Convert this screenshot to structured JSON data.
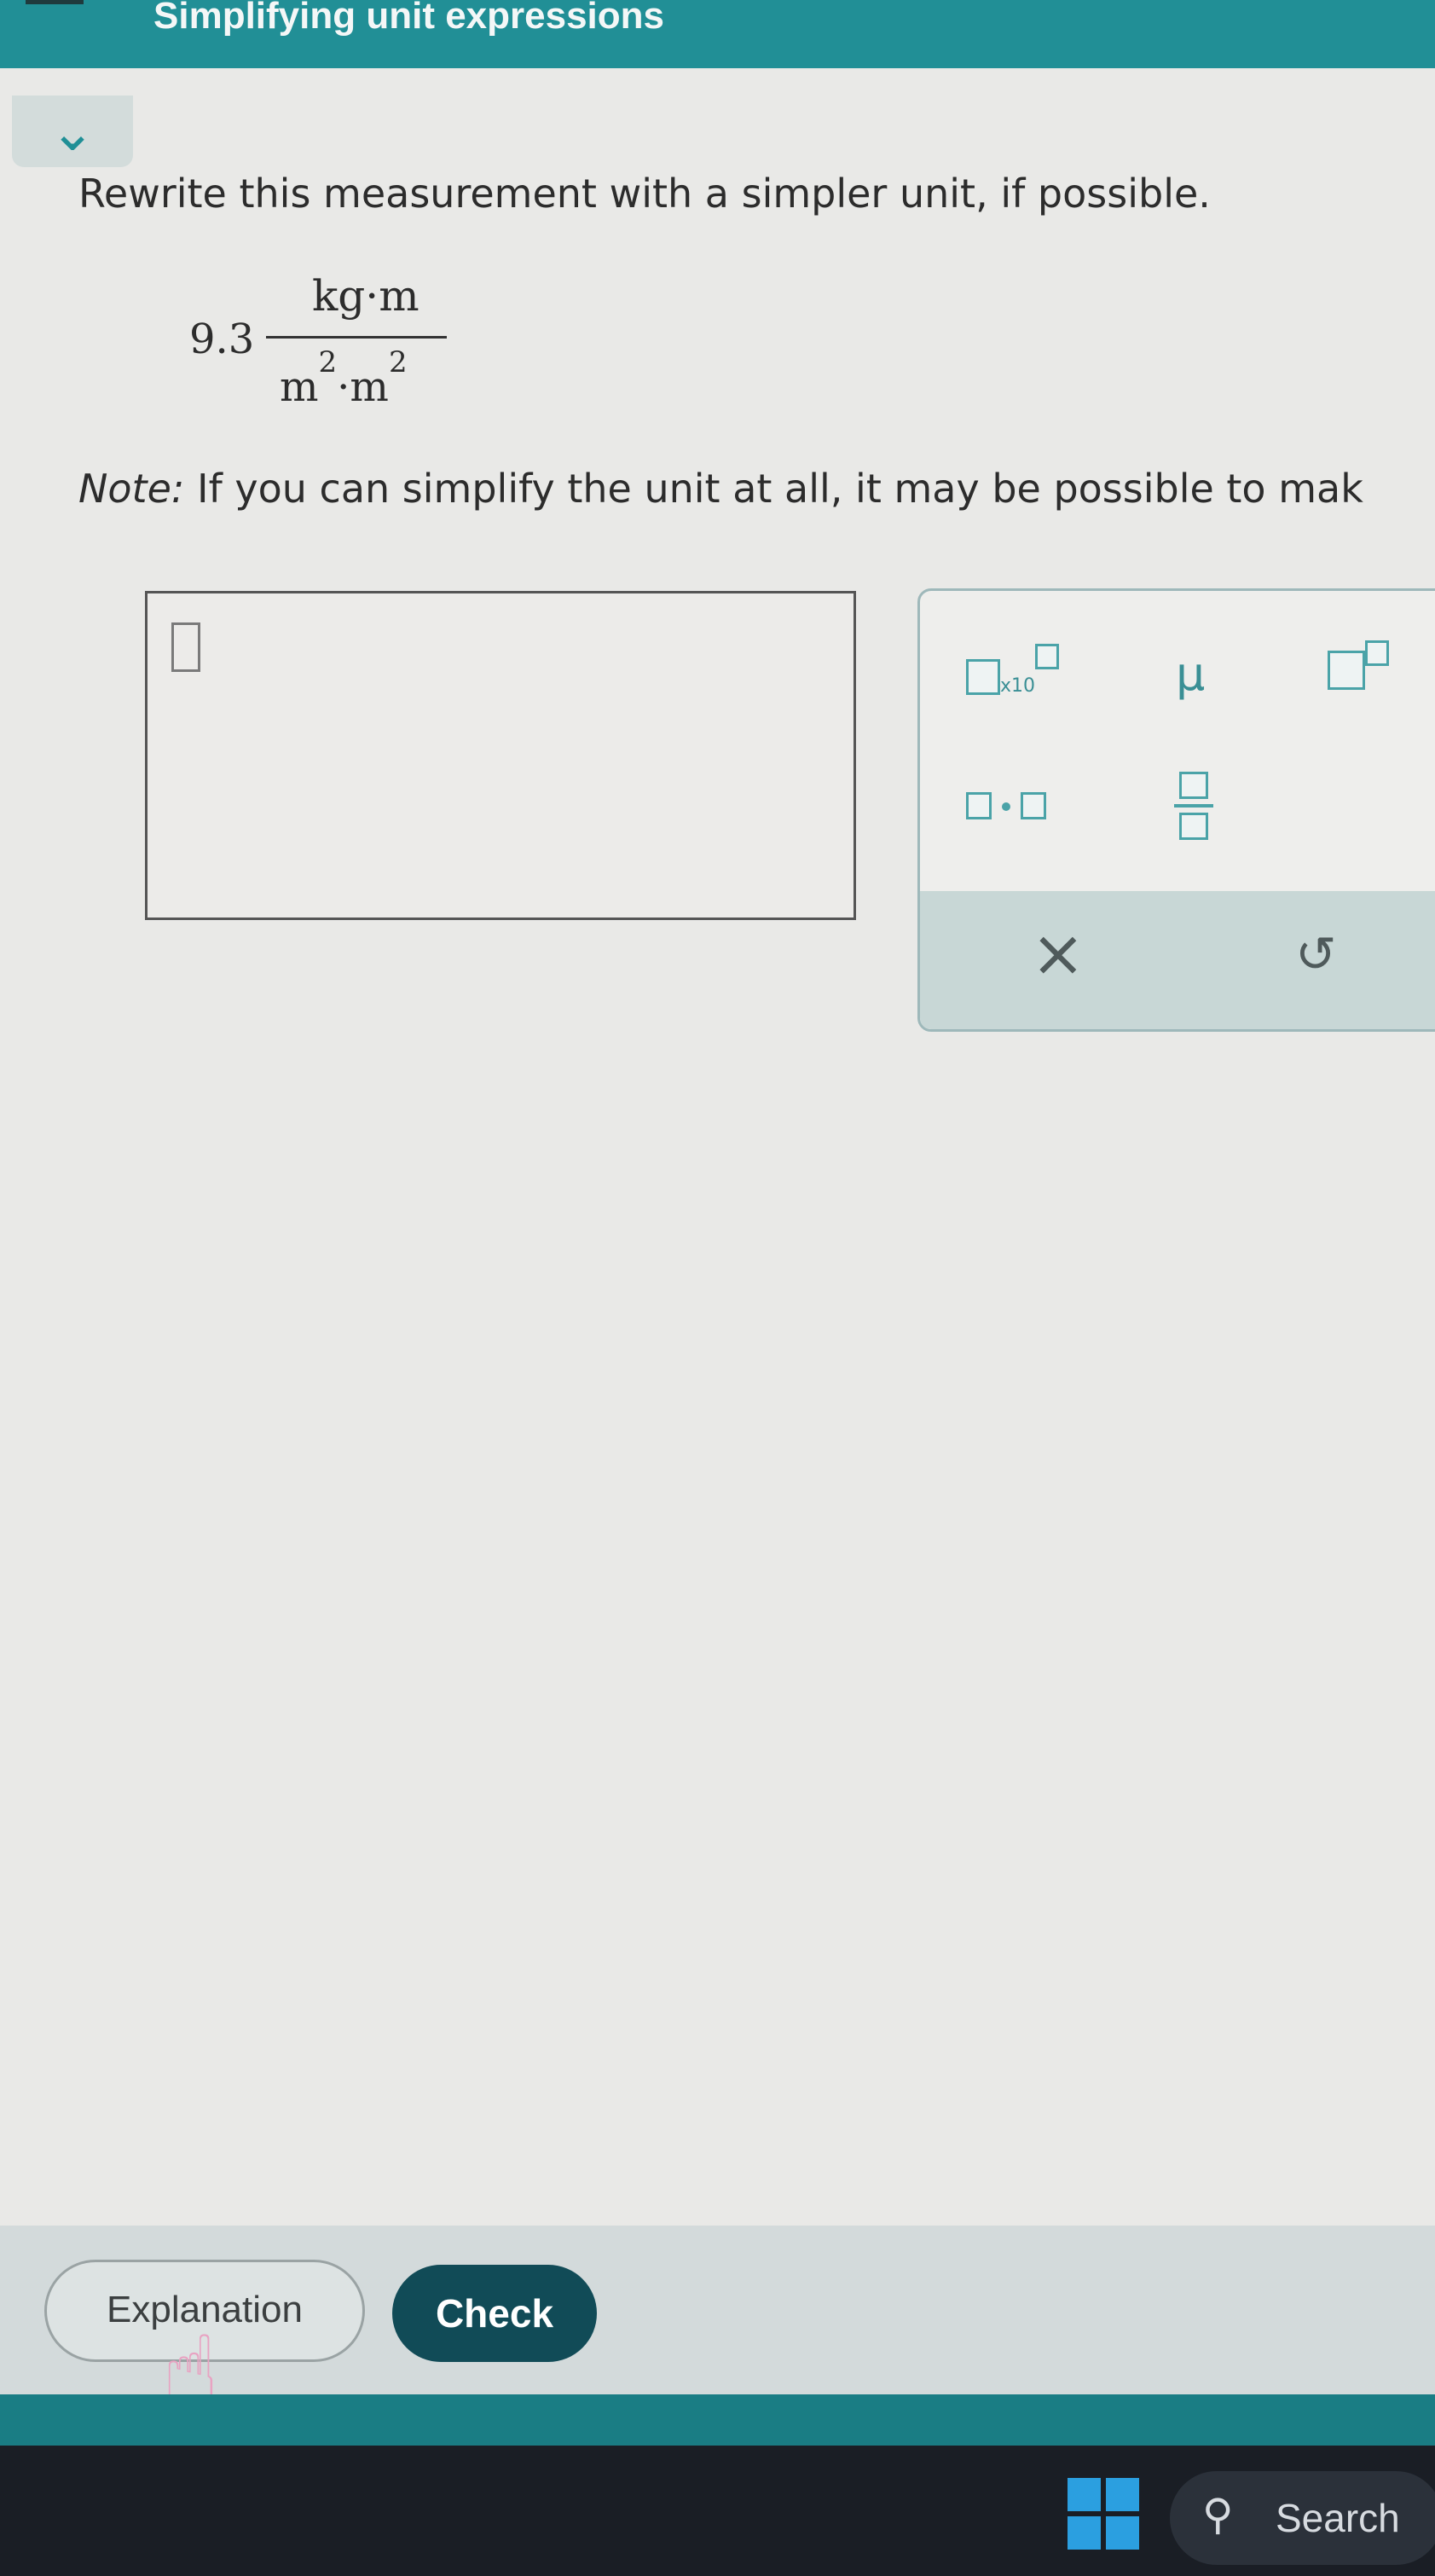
{
  "header": {
    "title": "Simplifying unit expressions"
  },
  "problem": {
    "prompt": "Rewrite this measurement with a simpler unit, if possible.",
    "coefficient": "9.3",
    "numerator": "kg·m",
    "denominator_base_1": "m",
    "denominator_exp_1": "2",
    "denominator_sep": "·m",
    "denominator_exp_2": "2",
    "note_label": "Note:",
    "note_text": " If you can simplify the unit at all, it may be possible to mak"
  },
  "keypad": {
    "sci_label": "x10",
    "mu": "μ",
    "clear": "×",
    "undo": "↺"
  },
  "footer": {
    "explanation_label": "Explanation",
    "check_label": "Check"
  },
  "taskbar": {
    "search_label": "Search"
  }
}
